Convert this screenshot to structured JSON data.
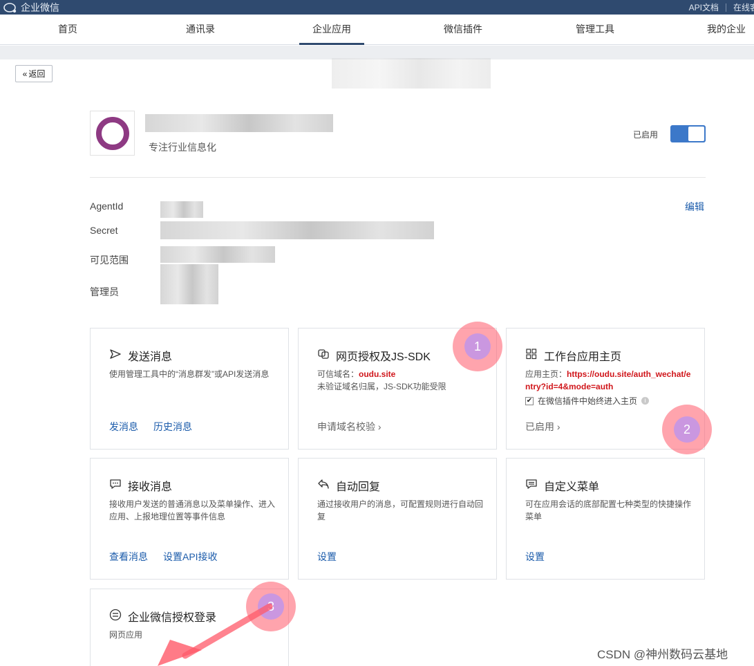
{
  "topbar": {
    "brand": "企业微信",
    "links": [
      "API文档",
      "在线客"
    ]
  },
  "nav": {
    "tabs": [
      "首页",
      "通讯录",
      "企业应用",
      "微信插件",
      "管理工具",
      "我的企业"
    ],
    "active": "企业应用"
  },
  "back_label": "返回",
  "app": {
    "description": "专注行业信息化",
    "status_label": "已启用",
    "enabled": true
  },
  "info": {
    "labels": [
      "AgentId",
      "Secret",
      "可见范围",
      "管理员"
    ],
    "edit_label": "编辑"
  },
  "cards": {
    "send": {
      "title": "发送消息",
      "desc": "使用管理工具中的“消息群发”或API发送消息",
      "links": [
        "发消息",
        "历史消息"
      ]
    },
    "jssdk": {
      "title": "网页授权及JS-SDK",
      "domain_label": "可信域名：",
      "domain_value": "oudu.site",
      "note": "未验证域名归属，JS-SDK功能受限",
      "link": "申请域名校验 ›"
    },
    "workbench": {
      "title": "工作台应用主页",
      "url_label": "应用主页：",
      "url_value": "https://oudu.site/auth_wechat/entry?id=4&mode=auth",
      "check_label": "在微信插件中始终进入主页",
      "link": "已启用 ›"
    },
    "receive": {
      "title": "接收消息",
      "desc": "接收用户发送的普通消息以及菜单操作、进入应用、上报地理位置等事件信息",
      "links": [
        "查看消息",
        "设置API接收"
      ]
    },
    "autoreply": {
      "title": "自动回复",
      "desc": "通过接收用户的消息，可配置规则进行自动回复",
      "link": "设置"
    },
    "menu": {
      "title": "自定义菜单",
      "desc": "可在应用会话的底部配置七种类型的快捷操作菜单",
      "link": "设置"
    },
    "login": {
      "title": "企业微信授权登录",
      "desc": "网页应用"
    }
  },
  "markers": [
    "1",
    "2",
    "3"
  ],
  "watermark": "CSDN @神州数码云基地",
  "colors": {
    "topbar": "#2f4a6f",
    "link": "#1c5cab",
    "highlight": "#d0161b",
    "toggle": "#3c78c9",
    "annotation": "#ff5a69"
  }
}
